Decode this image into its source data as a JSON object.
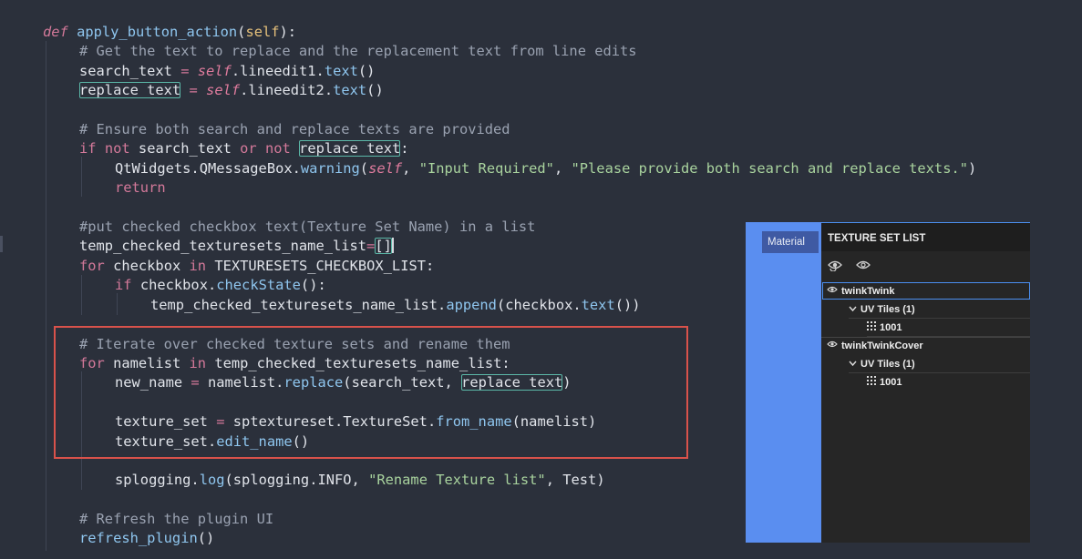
{
  "code": {
    "def_kw": "def",
    "func_name": "apply_button_action",
    "self_param": "self",
    "comment1": "# Get the text to replace and the replacement text from line edits",
    "search_text": "search_text",
    "replace_text": "replace_text",
    "self": "self",
    "lineedit1": "lineedit1",
    "lineedit2": "lineedit2",
    "text_method": "text",
    "comment2": "# Ensure both search and replace texts are provided",
    "if_kw": "if",
    "not_kw": "not",
    "or_kw": "or",
    "qtwidgets": "QtWidgets",
    "qmessagebox": "QMessageBox",
    "warning": "warning",
    "str_input_required": "\"Input Required\"",
    "str_please_provide": "\"Please provide both search and replace texts.\"",
    "return_kw": "return",
    "comment3": "#put checked checkbox text(Texture Set Name) in a list",
    "temp_list": "temp_checked_texturesets_name_list",
    "for_kw": "for",
    "in_kw": "in",
    "checkbox": "checkbox",
    "checkbox_list": "TEXTURESETS_CHECKBOX_LIST",
    "checkstate": "checkState",
    "append": "append",
    "comment4": "# Iterate over checked texture sets and rename them",
    "namelist": "namelist",
    "new_name": "new_name",
    "replace_method": "replace",
    "texture_set": "texture_set",
    "sptextureset": "sptextureset",
    "textureset_cls": "TextureSet",
    "from_name": "from_name",
    "edit_name": "edit_name",
    "splogging": "splogging",
    "log": "log",
    "info": "INFO",
    "str_rename": "\"Rename Texture list\"",
    "test": "Test",
    "comment5": "# Refresh the plugin UI",
    "refresh_plugin": "refresh_plugin"
  },
  "panel": {
    "material_tab": "Material",
    "header": "TEXTURE SET LIST",
    "tree": [
      {
        "label": "twinkTwink"
      },
      {
        "label": "UV Tiles (1)"
      },
      {
        "label": "1001"
      },
      {
        "label": "twinkTwinkCover"
      },
      {
        "label": "UV Tiles (1)"
      },
      {
        "label": "1001"
      }
    ]
  },
  "colors": {
    "editor_bg": "#2b303b",
    "keyword": "#d4799a",
    "function": "#8fc6ef",
    "string": "#a9d39e",
    "comment": "#9aa2b1",
    "annotation_box": "#d9524b",
    "panel_blue": "#5a8ef0",
    "panel_dark": "#262626"
  }
}
